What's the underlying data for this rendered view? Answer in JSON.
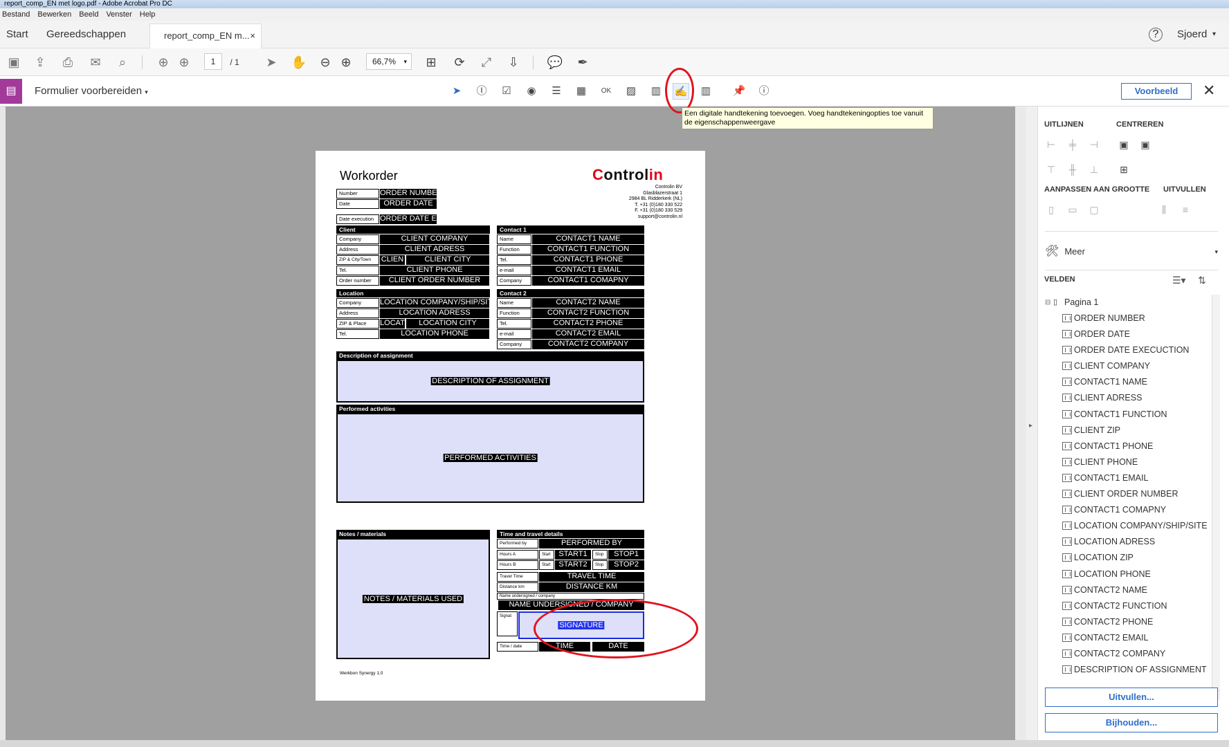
{
  "window": {
    "title": "report_comp_EN met logo.pdf - Adobe Acrobat Pro DC"
  },
  "menu": [
    "Bestand",
    "Bewerken",
    "Beeld",
    "Venster",
    "Help"
  ],
  "tabs": {
    "start": "Start",
    "tools": "Gereedschappen",
    "document": "report_comp_EN m...",
    "close": "×",
    "help": "?",
    "user": "Sjoerd"
  },
  "toolbar": {
    "page_current": "1",
    "page_total": "/ 1",
    "zoom": "66,7%"
  },
  "formbar": {
    "title": "Formulier voorbereiden",
    "preview": "Voorbeeld",
    "close": "✕"
  },
  "tooltip": "Een digitale handtekening toevoegen. Voeg handtekeningopties toe vanuit de eigenschappenweergave",
  "rightpanel": {
    "uitlijnen": "UITLIJNEN",
    "centreren": "CENTREREN",
    "aanpassen": "AANPASSEN AAN GROOTTE",
    "uitvullen": "UITVULLEN",
    "meer": "Meer",
    "velden": "VELDEN",
    "pagina": "Pagina 1",
    "fields": [
      "ORDER NUMBER",
      "ORDER DATE",
      "ORDER DATE EXECUCTION",
      "CLIENT COMPANY",
      "CONTACT1 NAME",
      "CLIENT ADRESS",
      "CONTACT1 FUNCTION",
      "CLIENT ZIP",
      "CONTACT1 PHONE",
      "CLIENT PHONE",
      "CONTACT1 EMAIL",
      "CLIENT ORDER NUMBER",
      "CONTACT1 COMAPNY",
      "LOCATION COMPANY/SHIP/SITE",
      "LOCATION ADRESS",
      "LOCATION ZIP",
      "LOCATION PHONE",
      "CONTACT2 NAME",
      "CONTACT2 FUNCTION",
      "CONTACT2 PHONE",
      "CONTACT2 EMAIL",
      "CONTACT2 COMPANY",
      "DESCRIPTION OF ASSIGNMENT"
    ],
    "btn_uitvullen": "Uitvullen...",
    "btn_bijhouden": "Bijhouden..."
  },
  "doc": {
    "title": "Workorder",
    "logo": {
      "c": "C",
      "ontrol": "ontrol",
      "in": "in"
    },
    "address": [
      "Controlin BV",
      "Glasblazerstraat 1",
      "2984 BL Ridderkerk (NL)",
      "T. +31 (0)180 330 522",
      "F. +31 (0)180 330 529",
      "support@controlin.nl"
    ],
    "labels": {
      "number": "Number",
      "date": "Date",
      "date_exec": "Date execution",
      "client": "Client",
      "contact1": "Contact 1",
      "location": "Location",
      "contact2": "Contact 2",
      "company": "Company",
      "address": "Address",
      "zip_city": "ZIP & City/Town",
      "tel": "Tel.",
      "order_number": "Order number",
      "name": "Name",
      "function": "Function",
      "email": "e-mail",
      "zip_place": "ZIP & Place",
      "desc": "Description of assignment",
      "performed": "Performed activities",
      "notes": "Notes / materials",
      "time_travel": "Time and travel details",
      "performed_by": "Performed by",
      "hours_a": "Hours A",
      "hours_b": "Hours B",
      "start": "Start",
      "stop": "Stop",
      "travel_time": "Travel Time",
      "distance": "Distance km",
      "name_undersigned": "Name undersigned / company",
      "signature": "Signat",
      "time_date": "Time / date",
      "footer": "Werkbon Synergy 1.0"
    },
    "fields": {
      "order_number": "ORDER NUMBER",
      "order_date": "ORDER DATE",
      "order_date_exec": "ORDER DATE EXCE",
      "client_company": "CLIENT COMPANY",
      "client_adress": "CLIENT ADRESS",
      "client_zip": "CLIEN",
      "client_city": "CLIENT CITY",
      "client_phone": "CLIENT PHONE",
      "client_order": "CLIENT ORDER NUMBER",
      "c1_name": "CONTACT1 NAME",
      "c1_function": "CONTACT1 FUNCTION",
      "c1_phone": "CONTACT1 PHONE",
      "c1_email": "CONTACT1 EMAIL",
      "c1_company": "CONTACT1 COMAPNY",
      "loc_company": "LOCATION COMPANY/SHIP/SITE",
      "loc_adress": "LOCATION ADRESS",
      "loc_zip": "LOCAT",
      "loc_city": "LOCATION CITY",
      "loc_phone": "LOCATION PHONE",
      "c2_name": "CONTACT2 NAME",
      "c2_function": "CONTACT2 FUNCTION",
      "c2_phone": "CONTACT2 PHONE",
      "c2_email": "CONTACT2 EMAIL",
      "c2_company": "CONTACT2 COMPANY",
      "desc": "DESCRIPTION OF ASSIGNMENT",
      "performed": "PERFORMED ACTIVITIES",
      "notes": "NOTES / MATERIALS USED",
      "performed_by": "PERFORMED BY",
      "start1": "START1",
      "stop1": "STOP1",
      "start2": "START2",
      "stop2": "STOP2",
      "travel_time": "TRAVEL TIME",
      "distance": "DISTANCE KM",
      "name_undersigned": "NAME UNDERSIGNED / COMPANY",
      "signature": "SIGNATURE",
      "time": "TIME",
      "date": "DATE"
    }
  }
}
